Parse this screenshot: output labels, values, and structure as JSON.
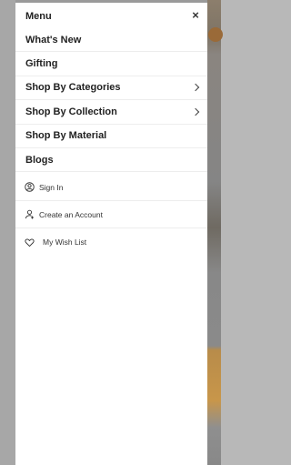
{
  "menu": {
    "title": "Menu",
    "close_icon": "close-icon"
  },
  "nav": {
    "items": [
      {
        "label": "What's New",
        "has_submenu": false
      },
      {
        "label": "Gifting",
        "has_submenu": false
      },
      {
        "label": "Shop By Categories",
        "has_submenu": true
      },
      {
        "label": "Shop By Collection",
        "has_submenu": true
      },
      {
        "label": "Shop By Material",
        "has_submenu": false
      },
      {
        "label": "Blogs",
        "has_submenu": false
      }
    ]
  },
  "account": {
    "sign_in": {
      "label": "Sign In",
      "icon": "user-circle-icon"
    },
    "create_account": {
      "label": "Create an Account",
      "icon": "user-add-icon"
    },
    "wish_list": {
      "label": "My Wish List",
      "icon": "heart-icon"
    }
  },
  "colors": {
    "drawer_bg": "#ffffff",
    "overlay": "#a9a9a9",
    "text": "#222222"
  }
}
